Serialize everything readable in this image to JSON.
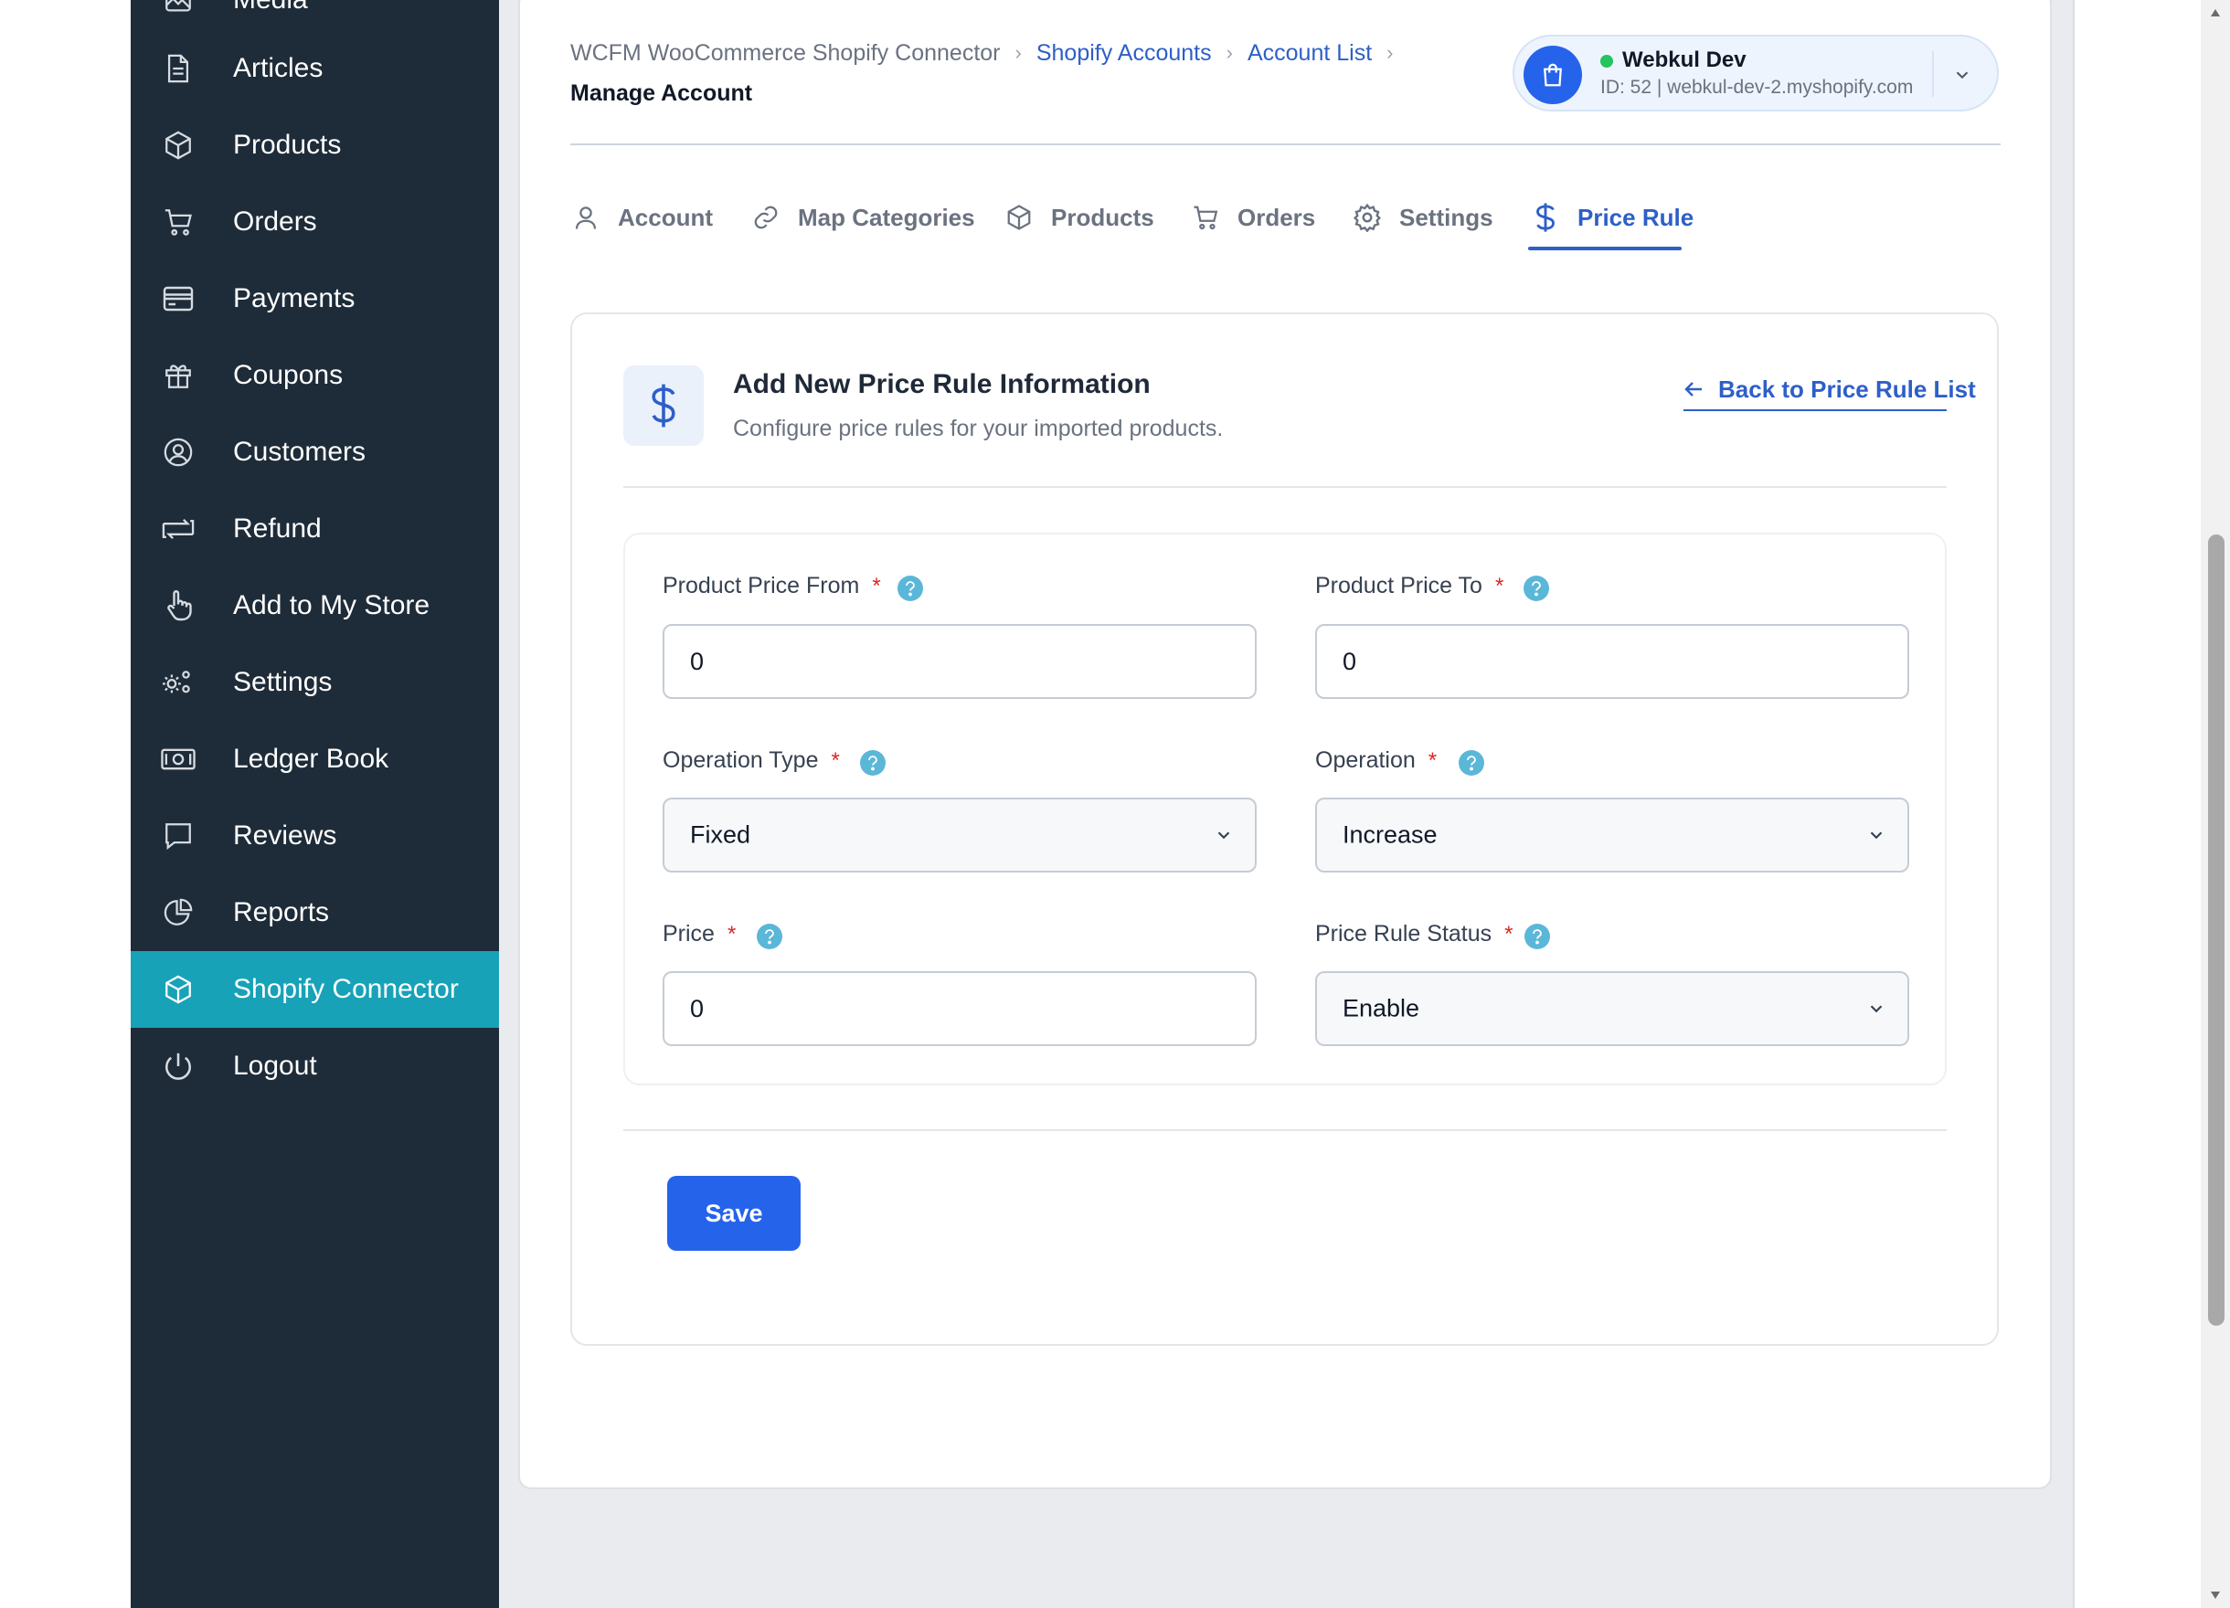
{
  "sidebar": {
    "items": [
      {
        "label": "Media",
        "icon": "media-icon"
      },
      {
        "label": "Articles",
        "icon": "article-icon"
      },
      {
        "label": "Products",
        "icon": "box-icon"
      },
      {
        "label": "Orders",
        "icon": "cart-icon"
      },
      {
        "label": "Payments",
        "icon": "credit-card-icon"
      },
      {
        "label": "Coupons",
        "icon": "gift-icon"
      },
      {
        "label": "Customers",
        "icon": "user-circle-icon"
      },
      {
        "label": "Refund",
        "icon": "refund-icon"
      },
      {
        "label": "Add to My Store",
        "icon": "hand-pointer-icon"
      },
      {
        "label": "Settings",
        "icon": "gears-icon"
      },
      {
        "label": "Ledger Book",
        "icon": "money-icon"
      },
      {
        "label": "Reviews",
        "icon": "comment-icon"
      },
      {
        "label": "Reports",
        "icon": "pie-chart-icon"
      },
      {
        "label": "Shopify Connector",
        "icon": "box-icon",
        "active": true
      },
      {
        "label": "Logout",
        "icon": "power-icon"
      }
    ]
  },
  "breadcrumb": {
    "root": "WCFM WooCommerce Shopify Connector",
    "link1": "Shopify Accounts",
    "link2": "Account List",
    "current": "Manage Account"
  },
  "account": {
    "name": "Webkul Dev",
    "detail": "ID: 52 | webkul-dev-2.myshopify.com",
    "status_color": "#22c55e"
  },
  "tabs": [
    {
      "label": "Account",
      "icon": "user-icon"
    },
    {
      "label": "Map Categories",
      "icon": "link-icon"
    },
    {
      "label": "Products",
      "icon": "box-icon"
    },
    {
      "label": "Orders",
      "icon": "cart-icon"
    },
    {
      "label": "Settings",
      "icon": "gear-icon"
    },
    {
      "label": "Price Rule",
      "icon": "dollar-icon",
      "active": true
    }
  ],
  "form": {
    "title": "Add New Price Rule Information",
    "subtitle": "Configure price rules for your imported products.",
    "back_label": "Back to Price Rule List",
    "fields": {
      "price_from": {
        "label": "Product Price From",
        "value": "0"
      },
      "price_to": {
        "label": "Product Price To",
        "value": "0"
      },
      "operation_type": {
        "label": "Operation Type",
        "value": "Fixed"
      },
      "operation": {
        "label": "Operation",
        "value": "Increase"
      },
      "price": {
        "label": "Price",
        "value": "0"
      },
      "status": {
        "label": "Price Rule Status",
        "value": "Enable"
      }
    },
    "required_mark": "*",
    "save_label": "Save"
  },
  "colors": {
    "sidebar_bg": "#1e2b38",
    "sidebar_active": "#17a2b8",
    "accent": "#2e5fc8",
    "primary_button": "#2563eb",
    "help_icon": "#5bb7d8"
  }
}
